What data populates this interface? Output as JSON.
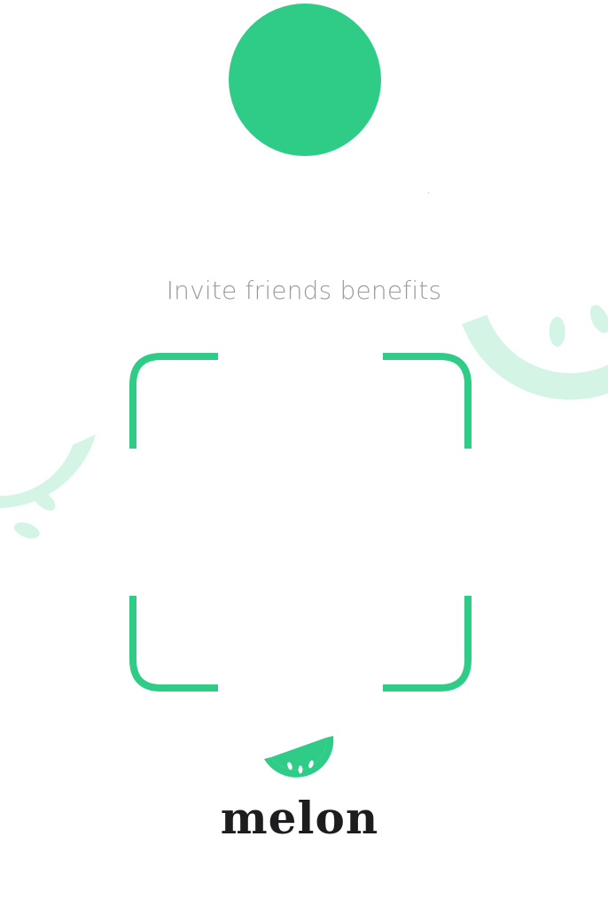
{
  "title": "Invite friends benefits",
  "brand": {
    "name": "melon",
    "icon": "melon-slice-icon"
  },
  "colors": {
    "accent": "#2ecc87",
    "accent_light": "#d4f5e6",
    "title_text": "#9a9a9a",
    "brand_text": "#1d1d1f"
  }
}
